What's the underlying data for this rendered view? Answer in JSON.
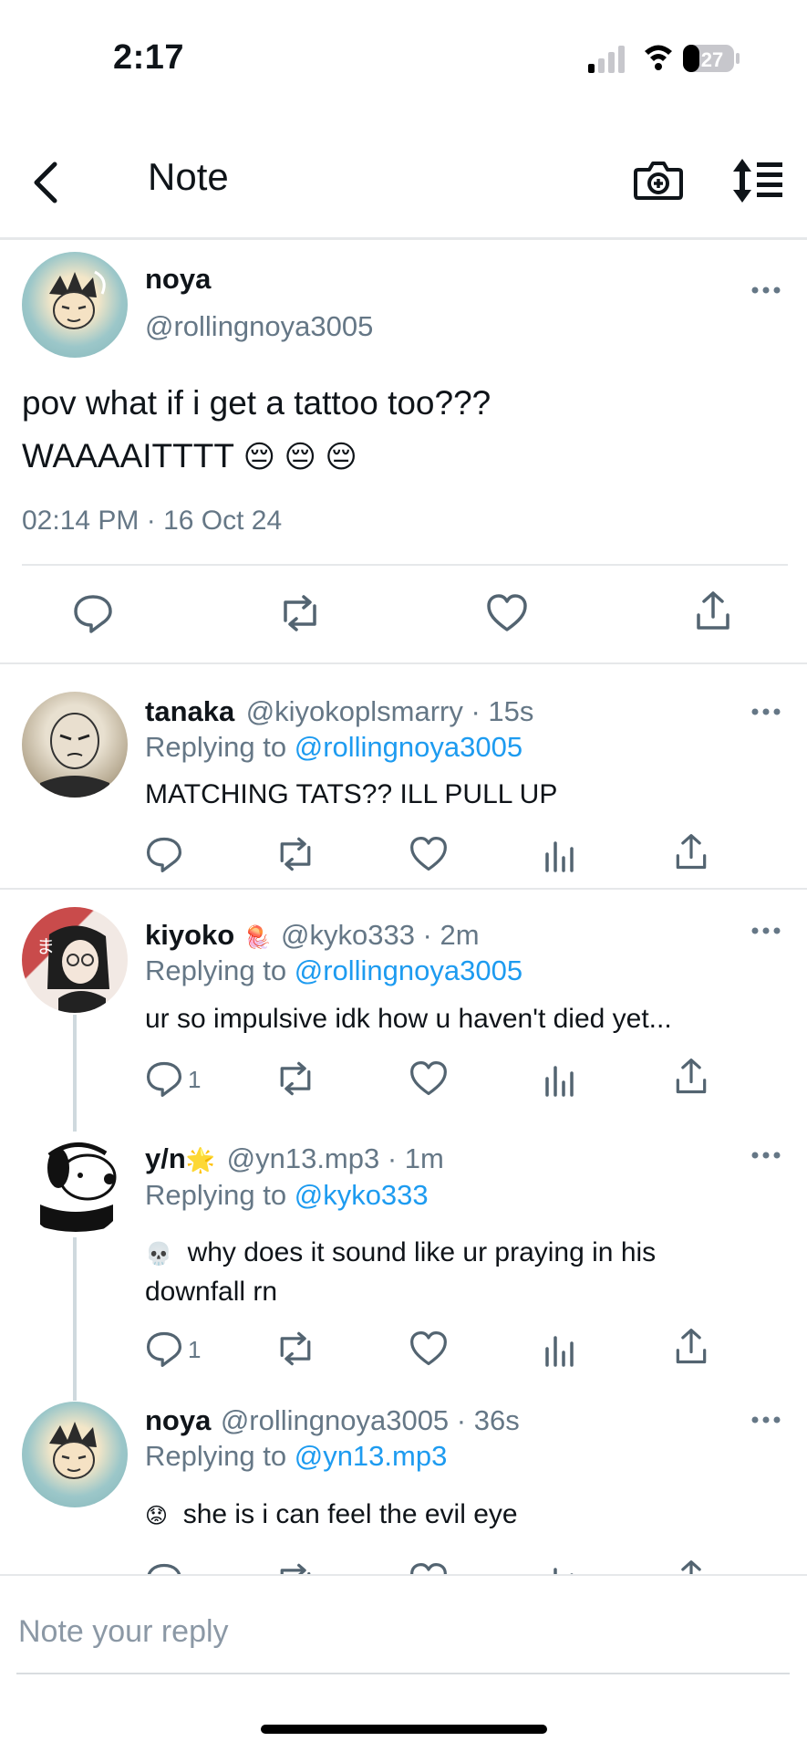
{
  "status_bar": {
    "time": "2:17",
    "battery": "27"
  },
  "nav": {
    "title": "Note"
  },
  "main_post": {
    "name": "noya",
    "handle": "@rollingnoya3005",
    "text_line1": "pov what if i get a tattoo too???",
    "text_line2": "WAAAAITTTT",
    "emojis": "😔 😔 😔",
    "timestamp": "02:14 PM · 16 Oct 24"
  },
  "replies": [
    {
      "name": "tanaka",
      "handle": "@kiyokoplsmarry · 15s",
      "replying_prefix": "Replying to ",
      "replying_to": "@rollingnoya3005",
      "text": "MATCHING TATS?? ILL PULL UP",
      "reply_count": ""
    },
    {
      "name": "kiyoko",
      "name_emoji": "🪼",
      "handle": "@kyko333 · 2m",
      "replying_prefix": "Replying to ",
      "replying_to": "@rollingnoya3005",
      "text": "ur so impulsive idk how u haven't died yet...",
      "reply_count": "1"
    },
    {
      "name": "y/n",
      "name_emoji": "🌟",
      "handle": "@yn13.mp3 · 1m",
      "replying_prefix": "Replying to ",
      "replying_to": "@kyko333",
      "text_emoji": "💀",
      "text_line1": "why does it sound like ur praying in his",
      "text_line2": "downfall rn",
      "reply_count": "1"
    },
    {
      "name": "noya",
      "handle": "@rollingnoya3005 · 36s",
      "replying_prefix": "Replying to ",
      "replying_to": "@yn13.mp3",
      "text_emoji": "😟",
      "text": "she is i can feel the evil eye"
    }
  ],
  "composer": {
    "placeholder": "Note your reply"
  },
  "colors": {
    "link": "#1d9bf0",
    "muted": "#657786",
    "text": "#0f1419",
    "divider": "#e6e8ea"
  }
}
